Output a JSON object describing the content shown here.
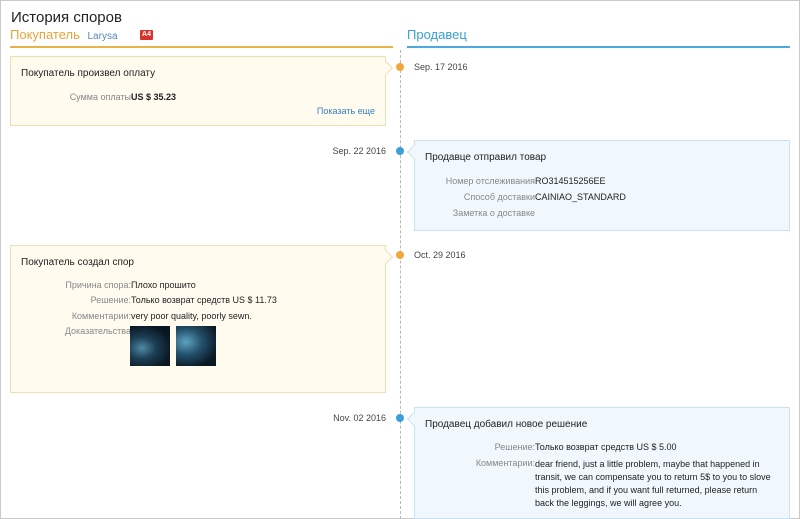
{
  "header": {
    "title": "История споров",
    "buyer_label": "Покупатель",
    "buyer_name": "Larysa",
    "badge": "A4",
    "seller_label": "Продавец"
  },
  "events": [
    {
      "date": "Sep. 17 2016",
      "title": "Покупатель произвел оплату",
      "fields": [
        {
          "label": "Сумма оплаты",
          "value": "US $ 35.23"
        }
      ],
      "more_link": "Показать еще"
    },
    {
      "date": "Sep. 22 2016",
      "title": "Продавце отправил товар",
      "fields": [
        {
          "label": "Номер отслеживания",
          "value": "RO314515256EE"
        },
        {
          "label": "Способ доставки",
          "value": "CAINIAO_STANDARD"
        },
        {
          "label": "Заметка о доставке",
          "value": ""
        }
      ]
    },
    {
      "date": "Oct. 29 2016",
      "title": "Покупатель создал спор",
      "fields": [
        {
          "label": "Причина спора:",
          "value": "Плохо прошито"
        },
        {
          "label": "Решение:",
          "value": "Только возврат средств US $ 11.73"
        },
        {
          "label": "Комментарии:",
          "value": "very poor quality, poorly sewn."
        },
        {
          "label": "Доказательства",
          "value": ""
        }
      ],
      "evidence": [
        {
          "icon": "evidence-photo-1"
        },
        {
          "icon": "evidence-photo-2"
        }
      ]
    },
    {
      "date": "Nov. 02 2016",
      "title": "Продавец добавил новое решение",
      "fields": [
        {
          "label": "Решение:",
          "value": "Только возврат средств US $ 5.00"
        },
        {
          "label": "Комментарии:",
          "value": "dear friend, just a little problem, maybe that happened in transit, we can compensate you to return 5$ to you to slove this problem, and if you want full returned, please return back the leggings, we will agree you."
        }
      ]
    }
  ],
  "colors": {
    "buyer_accent": "#e8a33a",
    "seller_accent": "#3a9fd6",
    "badge": "#d8342b",
    "link": "#3a7fc4"
  }
}
